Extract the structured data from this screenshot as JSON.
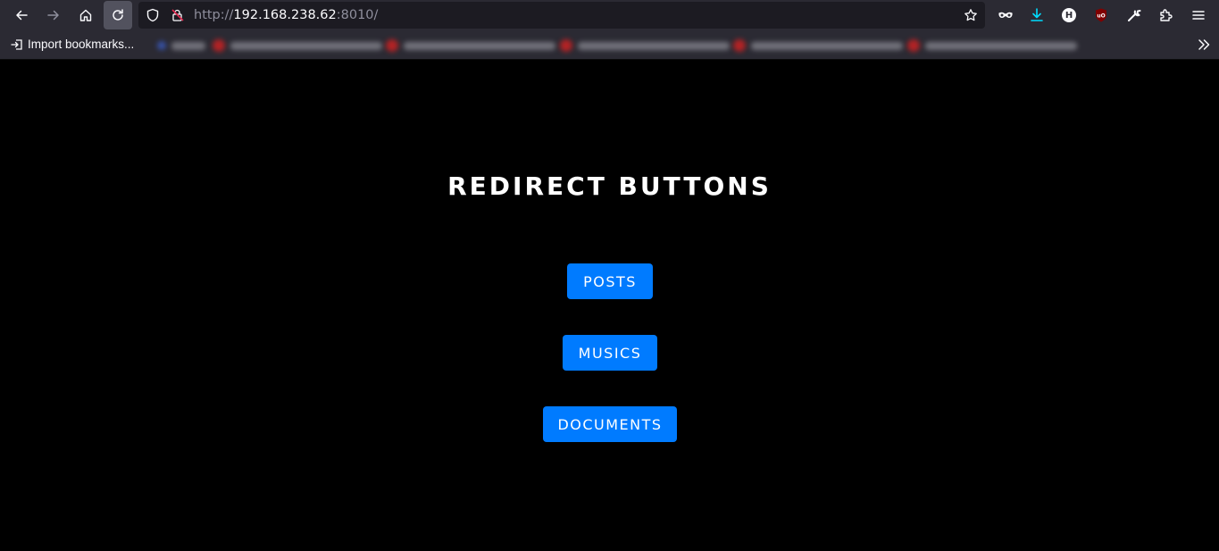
{
  "browser": {
    "url_scheme": "http://",
    "url_host": "192.168.238.62",
    "url_rest": ":8010/",
    "icons": {
      "back": "arrow-left-icon",
      "forward": "arrow-right-icon",
      "home": "home-icon",
      "reload": "reload-icon",
      "tracking": "shield-icon",
      "insecure": "insecure-lock-icon",
      "bookmark": "star-icon",
      "private": "mask-icon",
      "downloads": "download-icon",
      "h_extension": "H",
      "ublock": "ublock-icon",
      "devtools": "wrench-icon",
      "extensions": "puzzle-icon",
      "menu": "hamburger-menu-icon",
      "bookmarks_overflow": "double-chevron-icon"
    }
  },
  "bookmarks_bar": {
    "import_label": "Import bookmarks..."
  },
  "page": {
    "title": "REDIRECT BUTTONS",
    "buttons": [
      {
        "label": "POSTS"
      },
      {
        "label": "MUSICS"
      },
      {
        "label": "DOCUMENTS"
      }
    ]
  },
  "colors": {
    "page_background": "#000000",
    "button_background": "#007bff",
    "button_text": "#ffffff",
    "toolbar_background": "#2b2a33",
    "urlbar_background": "#1c1b22",
    "download_accent": "#00ddff"
  }
}
